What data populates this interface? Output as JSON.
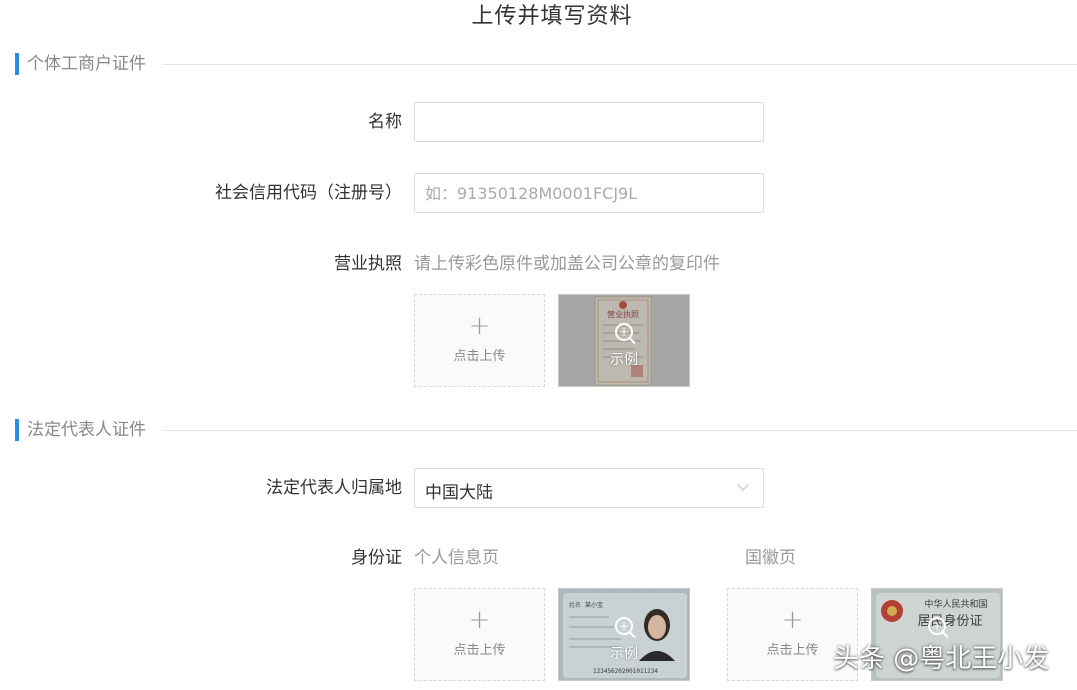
{
  "page": {
    "title": "上传并填写资料"
  },
  "sections": {
    "business": {
      "title": "个体工商户证件"
    },
    "legal_rep": {
      "title": "法定代表人证件"
    }
  },
  "fields": {
    "name": {
      "label": "名称",
      "value": "",
      "placeholder": ""
    },
    "credit_code": {
      "label": "社会信用代码（注册号）",
      "value": "",
      "placeholder": "如：91350128M0001FCJ9L"
    },
    "license": {
      "label": "营业执照",
      "hint": "请上传彩色原件或加盖公司公章的复印件"
    },
    "region": {
      "label": "法定代表人归属地",
      "selected": "中国大陆"
    },
    "id_card": {
      "label": "身份证",
      "front_hint": "个人信息页",
      "back_hint": "国徽页"
    }
  },
  "upload": {
    "label": "点击上传",
    "plus": "+"
  },
  "example": {
    "label": "示例"
  },
  "example_images": {
    "license_heading": "营业执照",
    "id_name": "某小宝",
    "id_number": "123456202001011234",
    "emblem_line1": "中华人民共和国",
    "emblem_line2": "居民身份证"
  },
  "watermark": {
    "text": "头条 @粤北王小发"
  },
  "colors": {
    "accent": "#2a8cdf",
    "border": "#dcdcdc",
    "placeholder": "#aaaaaa"
  }
}
